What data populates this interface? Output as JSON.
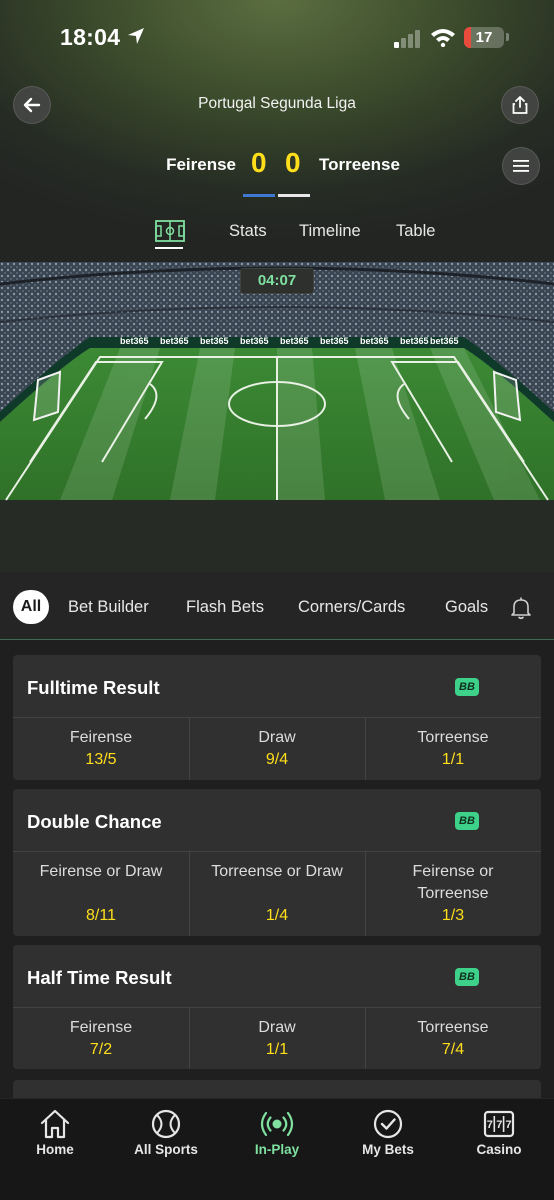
{
  "status_bar": {
    "time": "18:04",
    "battery": "17",
    "battery_level": 0.17
  },
  "header": {
    "league": "Portugal Segunda Liga",
    "home_team": "Feirense",
    "away_team": "Torreense",
    "home_score": "0",
    "away_score": "0"
  },
  "match_tabs": [
    "Stats",
    "Timeline",
    "Table"
  ],
  "pitch": {
    "clock": "04:07",
    "board_text": "bet365"
  },
  "market_tabs": {
    "active": "All",
    "items": [
      "Bet Builder",
      "Flash Bets",
      "Corners/Cards",
      "Goals"
    ]
  },
  "markets": [
    {
      "title": "Fulltime Result",
      "badge": "BB",
      "selections": [
        {
          "name": "Feirense",
          "odds": "13/5"
        },
        {
          "name": "Draw",
          "odds": "9/4"
        },
        {
          "name": "Torreense",
          "odds": "1/1"
        }
      ]
    },
    {
      "title": "Double Chance",
      "badge": "BB",
      "selections": [
        {
          "name": "Feirense or Draw",
          "odds": "8/11"
        },
        {
          "name": "Torreense or Draw",
          "odds": "1/4"
        },
        {
          "name": "Feirense or Torreense",
          "odds": "1/3"
        }
      ]
    },
    {
      "title": "Half Time Result",
      "badge": "BB",
      "selections": [
        {
          "name": "Feirense",
          "odds": "7/2"
        },
        {
          "name": "Draw",
          "odds": "1/1"
        },
        {
          "name": "Torreense",
          "odds": "7/4"
        }
      ]
    }
  ],
  "bottom_nav": [
    {
      "label": "Home",
      "icon": "home-icon"
    },
    {
      "label": "All Sports",
      "icon": "ball-icon"
    },
    {
      "label": "In-Play",
      "icon": "broadcast-icon",
      "active": true
    },
    {
      "label": "My Bets",
      "icon": "check-circle-icon"
    },
    {
      "label": "Casino",
      "icon": "slot-machine-icon"
    }
  ],
  "colors": {
    "accent_green": "#7fe0a0",
    "odds_yellow": "#ffdf1b",
    "bb_green": "#3ed18a",
    "home_blue": "#3f78d3"
  }
}
